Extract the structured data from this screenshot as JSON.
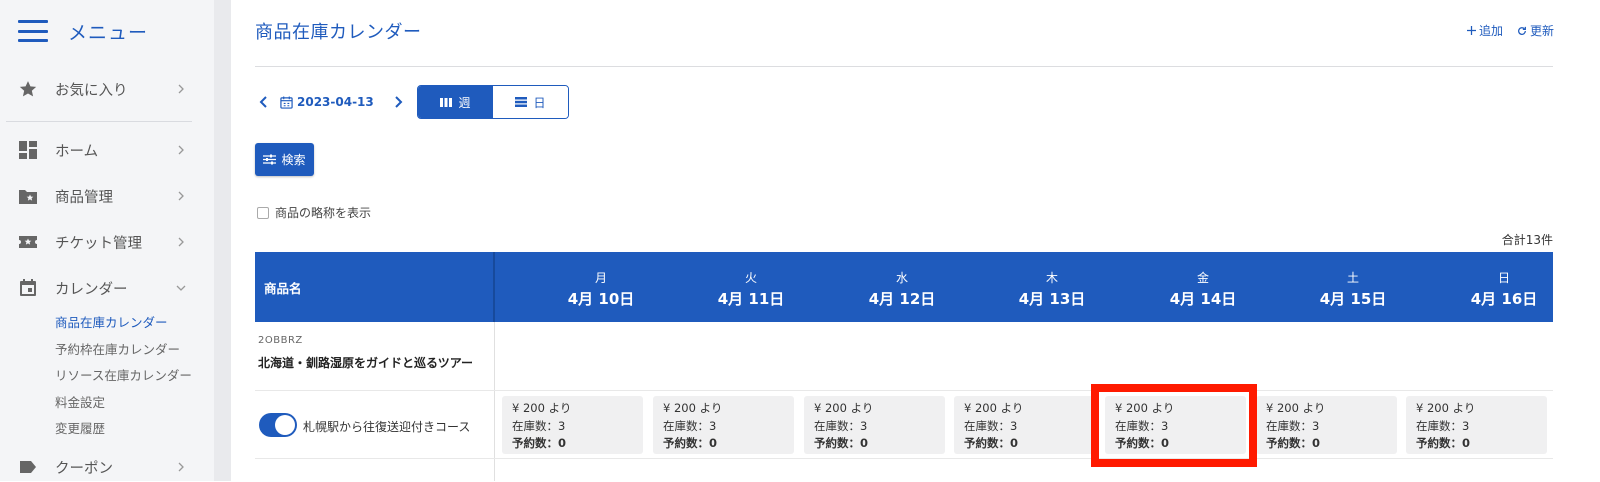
{
  "sidebar": {
    "menu_title": "メニュー",
    "items": [
      {
        "label": "お気に入り",
        "icon": "star-icon",
        "chevron": "right"
      },
      {
        "label": "ホーム",
        "icon": "dashboard-icon",
        "chevron": "right"
      },
      {
        "label": "商品管理",
        "icon": "folder-star-icon",
        "chevron": "right"
      },
      {
        "label": "チケット管理",
        "icon": "ticket-icon",
        "chevron": "right"
      },
      {
        "label": "カレンダー",
        "icon": "calendar-icon",
        "chevron": "down"
      },
      {
        "label": "クーポン",
        "icon": "tag-icon",
        "chevron": "right"
      }
    ],
    "calendar_sub": [
      "商品在庫カレンダー",
      "予約枠在庫カレンダー",
      "リソース在庫カレンダー",
      "料金設定",
      "変更履歴"
    ]
  },
  "header": {
    "title": "商品在庫カレンダー",
    "add_label": "追加",
    "refresh_label": "更新"
  },
  "date_nav": {
    "date": "2023-04-13"
  },
  "view_toggle": {
    "week_label": "週",
    "day_label": "日",
    "selected": "week"
  },
  "search_label": "検索",
  "abbr_label": "商品の略称を表示",
  "total_label": "合計13件",
  "table": {
    "name_header": "商品名",
    "days": [
      {
        "dow": "月",
        "date": "4月 10日"
      },
      {
        "dow": "火",
        "date": "4月 11日"
      },
      {
        "dow": "水",
        "date": "4月 12日"
      },
      {
        "dow": "木",
        "date": "4月 13日"
      },
      {
        "dow": "金",
        "date": "4月 14日"
      },
      {
        "dow": "土",
        "date": "4月 15日"
      },
      {
        "dow": "日",
        "date": "4月 16日"
      }
    ],
    "product": {
      "code": "2OBBRZ",
      "name": "北海道・釧路湿原をガイドと巡るツアー"
    },
    "course": {
      "name": "札幌駅から往復送迎付きコース",
      "enabled": true,
      "cells": [
        {
          "price": "¥ 200 より",
          "stock": "在庫数：3",
          "reserved": "予約数：0"
        },
        {
          "price": "¥ 200 より",
          "stock": "在庫数：3",
          "reserved": "予約数：0"
        },
        {
          "price": "¥ 200 より",
          "stock": "在庫数：3",
          "reserved": "予約数：0"
        },
        {
          "price": "¥ 200 より",
          "stock": "在庫数：3",
          "reserved": "予約数：0"
        },
        {
          "price": "¥ 200 より",
          "stock": "在庫数：3",
          "reserved": "予約数：0"
        },
        {
          "price": "¥ 200 より",
          "stock": "在庫数：3",
          "reserved": "予約数：0"
        },
        {
          "price": "¥ 200 より",
          "stock": "在庫数：3",
          "reserved": "予約数：0"
        }
      ]
    }
  },
  "colors": {
    "accent": "#1f5bbd",
    "highlight": "#ff1a00"
  }
}
